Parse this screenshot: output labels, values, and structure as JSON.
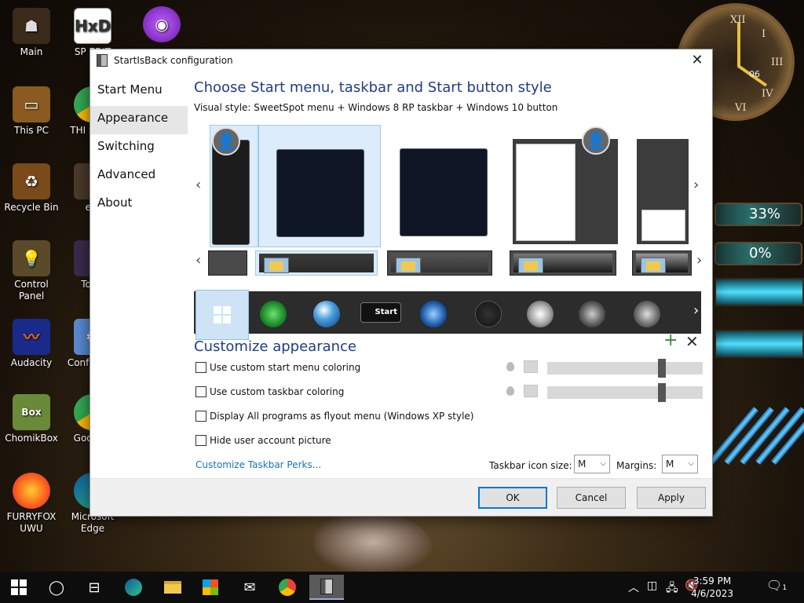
{
  "desktop": {
    "icons": [
      {
        "label": "Main",
        "icon": "main-icon"
      },
      {
        "label": "This PC",
        "icon": "this-pc-icon"
      },
      {
        "label": "Recycle Bin",
        "icon": "recycle-bin-icon"
      },
      {
        "label": "Control Panel",
        "icon": "control-panel-icon"
      },
      {
        "label": "Audacity",
        "icon": "audacity-icon"
      },
      {
        "label": "ChomikBox",
        "icon": "chomikbox-icon"
      },
      {
        "label": "FURRYFOX UWU",
        "icon": "firefox-icon"
      },
      {
        "label": "SP EDIT",
        "icon": "hxd-icon"
      },
      {
        "label": "THI SPYW",
        "icon": "chrome-icon"
      },
      {
        "label": "ext",
        "icon": "ext-icon"
      },
      {
        "label": "Tor B",
        "icon": "tor-icon"
      },
      {
        "label": "Conf Explo",
        "icon": "config-icon"
      },
      {
        "label": "Goo Chr",
        "icon": "chrome-icon"
      },
      {
        "label": "Microsoft Edge",
        "icon": "edge-icon"
      }
    ],
    "gauge_top": "33%",
    "gauge_bottom": "0%",
    "clock_day": "06"
  },
  "dialog": {
    "title": "StartIsBack configuration",
    "nav": [
      "Start Menu",
      "Appearance",
      "Switching",
      "Advanced",
      "About"
    ],
    "active_nav": "Appearance",
    "heading": "Choose Start menu, taskbar and Start button style",
    "visual_style": "Visual style:  SweetSpot menu + Windows 8 RP taskbar + Windows 10 button",
    "start_button_label": "Start",
    "customize_heading": "Customize appearance",
    "checkboxes": [
      {
        "label": "Use custom start menu coloring",
        "checked": false
      },
      {
        "label": "Use custom taskbar coloring",
        "checked": false
      },
      {
        "label": "Display All programs as flyout menu (Windows XP style)",
        "checked": false
      },
      {
        "label": "Hide user account picture",
        "checked": false
      }
    ],
    "sliders": [
      0.75,
      0.75
    ],
    "perks_link": "Customize Taskbar Perks...",
    "icon_size_label": "Taskbar icon size:",
    "icon_size_value": "M",
    "margins_label": "Margins:",
    "margins_value": "M",
    "ok": "OK",
    "cancel": "Cancel",
    "apply": "Apply"
  },
  "taskbar": {
    "time": "3:59 PM",
    "date": "4/6/2023",
    "notification_count": "1"
  }
}
